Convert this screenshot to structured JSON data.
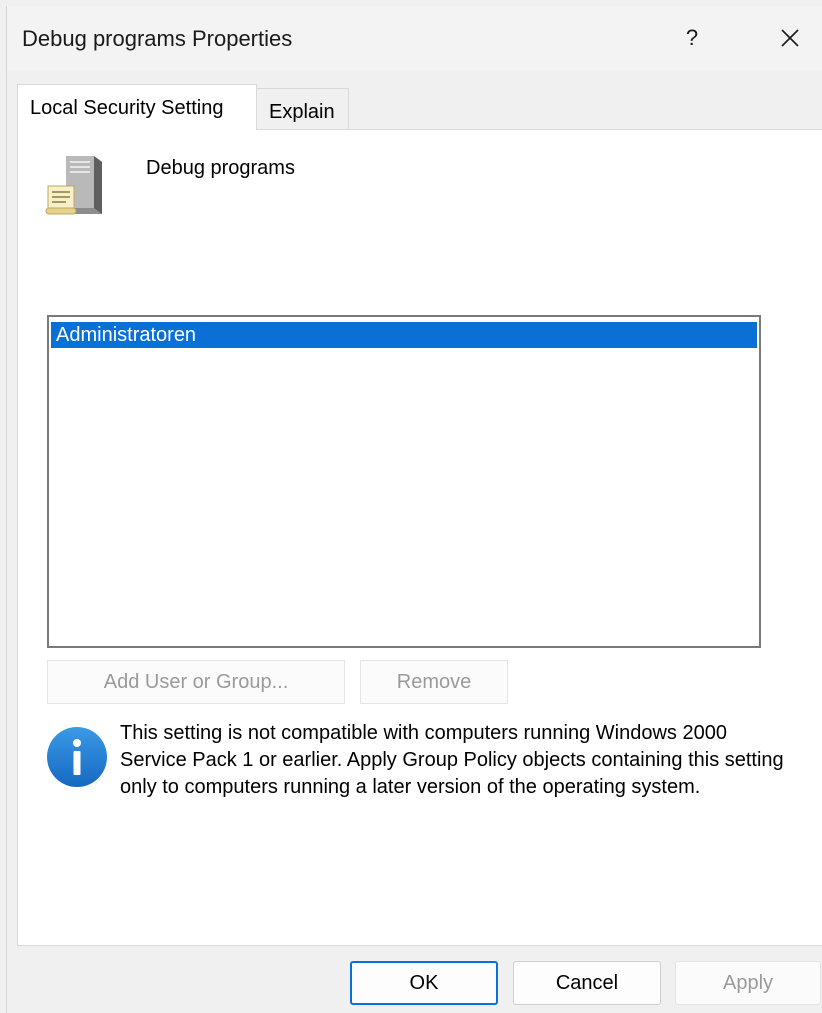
{
  "window": {
    "title": "Debug programs Properties",
    "help_label": "?",
    "close_icon": "close-icon"
  },
  "tabs": [
    {
      "label": "Local Security Setting",
      "active": true
    },
    {
      "label": "Explain",
      "active": false
    }
  ],
  "policy": {
    "name": "Debug programs",
    "icon": "server-policy-icon"
  },
  "user_list": {
    "items": [
      {
        "label": "Administratoren",
        "selected": true
      }
    ]
  },
  "list_buttons": {
    "add_label": "Add User or Group...",
    "remove_label": "Remove"
  },
  "info": {
    "icon": "info-icon",
    "text": "This setting is not compatible with computers running Windows 2000 Service Pack 1 or earlier.  Apply Group Policy objects containing this setting only to computers running a later version of the operating system."
  },
  "footer": {
    "ok_label": "OK",
    "cancel_label": "Cancel",
    "apply_label": "Apply"
  },
  "colors": {
    "selection": "#0a6fd6",
    "info_blue": "#1a7fd4",
    "disabled_text": "#9a9a9a"
  }
}
